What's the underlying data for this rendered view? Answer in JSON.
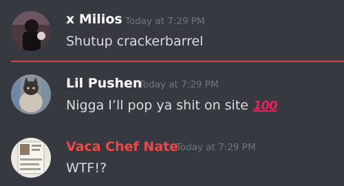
{
  "messages": [
    {
      "username": "x Milios",
      "timestamp": "Today at 7:29 PM",
      "text": "Shutup crackerbarrel",
      "name_color": "#ffffff"
    },
    {
      "username": "Lil Pushen",
      "timestamp": "Today at 7:29 PM",
      "text": "Nigga I’ll pop ya shit on site",
      "emoji": "100-icon",
      "emoji_text": "100",
      "name_color": "#ffffff"
    },
    {
      "username": "Vaca Chef Nate",
      "timestamp": "Today at 7:29 PM",
      "text": "WTF!?",
      "name_color": "#f04747"
    }
  ],
  "colors": {
    "background": "#36393f",
    "timestamp": "#72767d",
    "message_text": "#dcddde",
    "new_messages_divider": "#f04747"
  }
}
